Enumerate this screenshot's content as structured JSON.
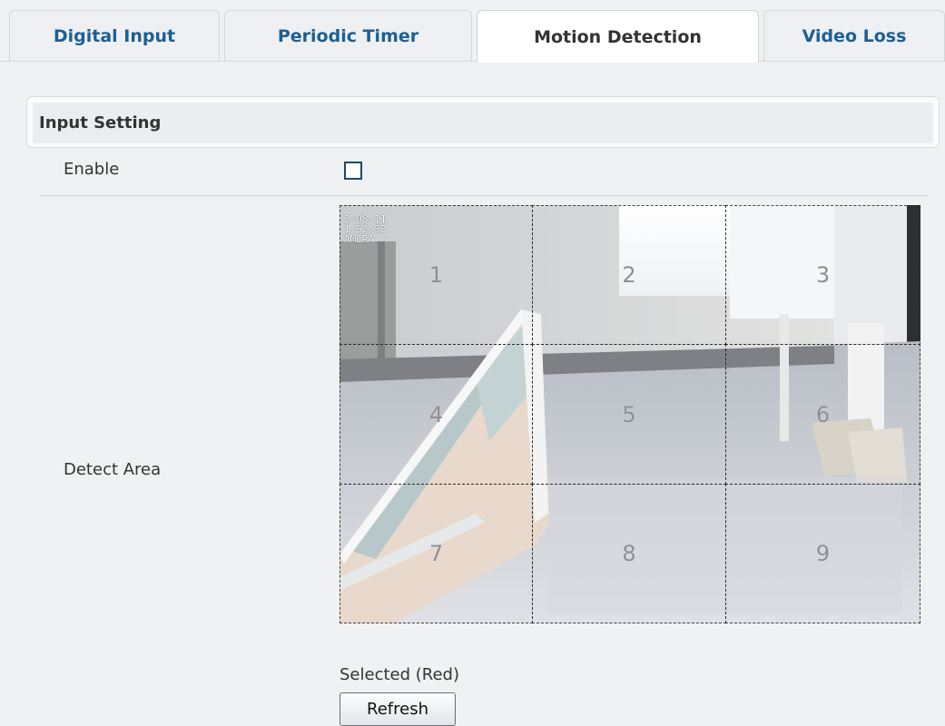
{
  "tabs": [
    {
      "label": "Digital Input",
      "active": false
    },
    {
      "label": "Periodic Timer",
      "active": false
    },
    {
      "label": "Motion Detection",
      "active": true
    },
    {
      "label": "Video Loss",
      "active": false
    }
  ],
  "section": {
    "title": "Input Setting",
    "enable_label": "Enable",
    "enable_checked": false,
    "detect_area_label": "Detect Area"
  },
  "camera": {
    "osd_text": "2-08-11\n1:52:52\nAMERA",
    "grid_cells": [
      "1",
      "2",
      "3",
      "4",
      "5",
      "6",
      "7",
      "8",
      "9"
    ]
  },
  "selected_note": "Selected (Red)",
  "refresh_label": "Refresh",
  "colors": {
    "tab_text": "#1d5f94",
    "active_tab_text": "#333333",
    "background": "#f0f1f3"
  }
}
